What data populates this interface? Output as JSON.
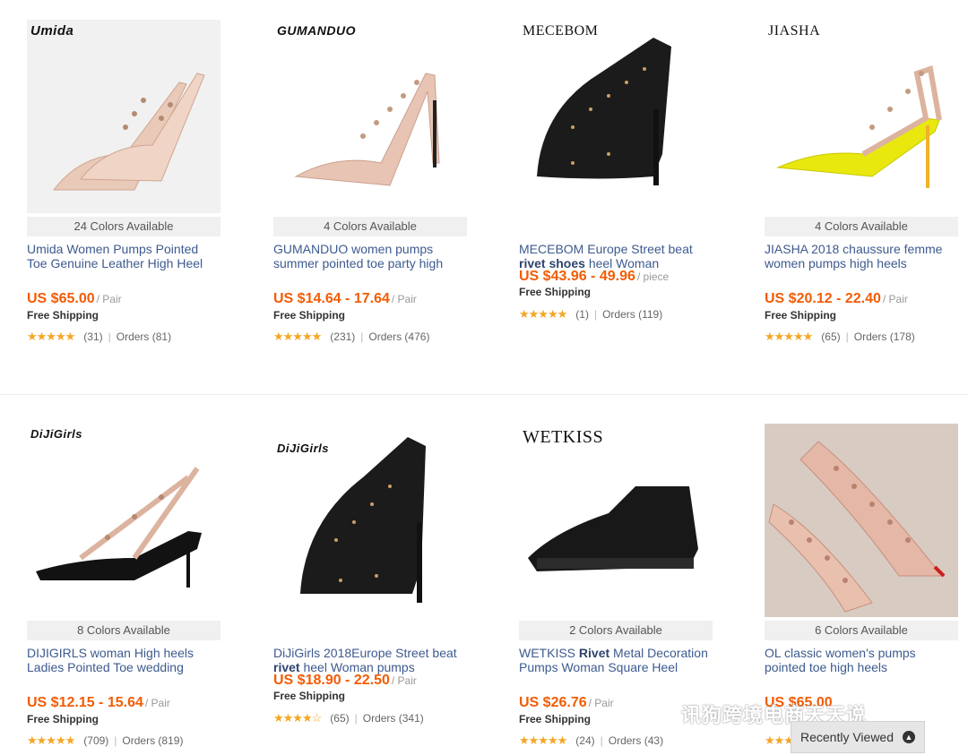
{
  "products": [
    {
      "brand": "Umida",
      "colors": "24 Colors Available",
      "title": "Umida Women Pumps Pointed Toe Genuine Leather High Heel",
      "price": "US $65.00",
      "unit": "/ Pair",
      "shipping": "Free Shipping",
      "reviews": "(31)",
      "orders": "Orders (81)"
    },
    {
      "brand": "GUMANDUO",
      "colors": "4 Colors Available",
      "title": "GUMANDUO women pumps summer pointed toe party high",
      "price": "US $14.64 - 17.64",
      "unit": "/ Pair",
      "shipping": "Free Shipping",
      "reviews": "(231)",
      "orders": "Orders (476)"
    },
    {
      "brand": "MECEBOM",
      "colors": "",
      "title_pre": "MECEBOM Europe Street beat ",
      "title_bold": "rivet shoes",
      "title_post": " heel Woman",
      "price": "US $43.96 - 49.96",
      "unit": "/ piece",
      "shipping": "Free Shipping",
      "reviews": "(1)",
      "orders": "Orders (119)"
    },
    {
      "brand": "JIASHA",
      "colors": "4 Colors Available",
      "title": "JIASHA 2018 chaussure femme women pumps high heels",
      "price": "US $20.12 - 22.40",
      "unit": "/ Pair",
      "shipping": "Free Shipping",
      "reviews": "(65)",
      "orders": "Orders (178)"
    },
    {
      "brand": "DiJiGirls",
      "colors": "8 Colors Available",
      "title": "DIJIGIRLS woman High heels Ladies Pointed Toe wedding",
      "price": "US $12.15 - 15.64",
      "unit": "/ Pair",
      "shipping": "Free Shipping",
      "reviews": "(709)",
      "orders": "Orders (819)"
    },
    {
      "brand": "DiJiGirls",
      "colors": "",
      "title_pre": "DiJiGirls 2018Europe Street beat ",
      "title_bold": "rivet",
      "title_post": " heel Woman pumps",
      "price": "US $18.90 - 22.50",
      "unit": "/ Pair",
      "shipping": "Free Shipping",
      "reviews": "(65)",
      "orders": "Orders (341)"
    },
    {
      "brand": "WETKISS",
      "colors": "2 Colors Available",
      "title_pre": "WETKISS ",
      "title_bold": "Rivet",
      "title_post": " Metal Decoration Pumps Woman Square Heel",
      "price": "US $26.76",
      "unit": "/ Pair",
      "shipping": "Free Shipping",
      "reviews": "(24)",
      "orders": "Orders (43)"
    },
    {
      "brand": "",
      "colors": "6 Colors Available",
      "title": "OL classic women's pumps pointed toe high heels",
      "price": "US $65.00",
      "unit": "",
      "shipping": "",
      "reviews": "",
      "orders": ""
    }
  ],
  "ratings": [
    5,
    4.5,
    5,
    5,
    5,
    4,
    5,
    5
  ],
  "recently_viewed": "Recently Viewed",
  "watermark": "讯狗跨境电商天天说",
  "accent_color": "#f25c05",
  "star_color": "#f5a623"
}
